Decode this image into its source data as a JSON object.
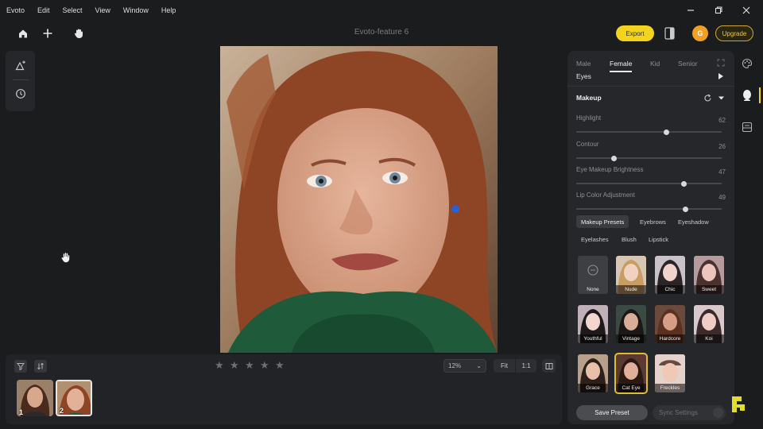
{
  "menubar": {
    "items": [
      "Evoto",
      "Edit",
      "Select",
      "View",
      "Window",
      "Help"
    ]
  },
  "toolbar": {
    "doc_title": "Evoto-feature 6",
    "export_label": "Export",
    "avatar_letter": "G",
    "upgrade_label": "Upgrade"
  },
  "filmstrip": {
    "zoom": "12%",
    "fit_label": "Fit",
    "one_label": "1:1",
    "thumb_numbers": [
      "1",
      "2"
    ]
  },
  "panel": {
    "gender_tabs": [
      "Male",
      "Female",
      "Kid",
      "Senior"
    ],
    "section_eyes": "Eyes",
    "section_makeup": "Makeup",
    "sliders": [
      {
        "label": "Highlight",
        "value": "62",
        "level": 0.62
      },
      {
        "label": "Contour",
        "value": "26",
        "level": 0.26
      },
      {
        "label": "Eye Makeup Brightness",
        "value": "47",
        "level": 0.74
      },
      {
        "label": "Lip Color Adjustment",
        "value": "49",
        "level": 0.75
      }
    ],
    "subtabs_row1": [
      "Makeup Presets",
      "Eyebrows",
      "Eyeshadow"
    ],
    "subtabs_row2": [
      "Eyelashes",
      "Blush",
      "Lipstick"
    ],
    "presets": [
      "None",
      "Nude",
      "Chic",
      "Sweet",
      "Youthful",
      "Vintage",
      "Hardcore",
      "Koi",
      "Grace",
      "Cat Eye",
      "Freckles"
    ],
    "save_preset": "Save Preset",
    "sync_settings": "Sync Settings"
  },
  "colors": {
    "accent": "#f2d41e",
    "avatar": "#f2a024",
    "background": "#1b1c1e",
    "panel": "#26272a"
  }
}
